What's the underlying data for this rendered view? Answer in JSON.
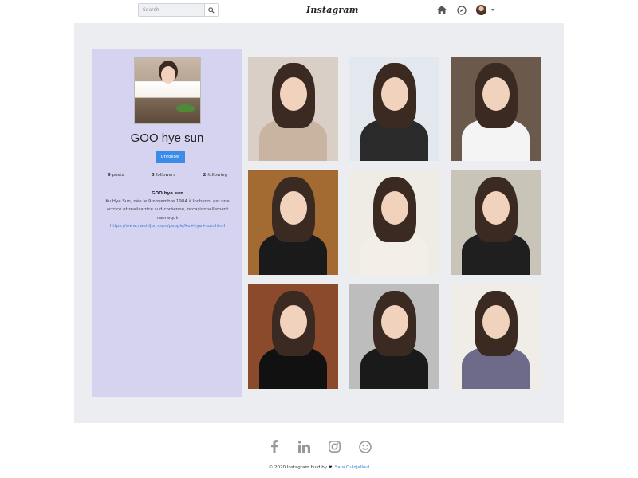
{
  "navbar": {
    "search_placeholder": "Search",
    "logo": "Instagram",
    "icons": [
      "home-icon",
      "explore-icon",
      "avatar",
      "caret-down-icon"
    ]
  },
  "profile": {
    "name": "GOO hye sun",
    "unfollow_label": "Unfollow",
    "stats": {
      "posts_count": "9",
      "posts_label": "posts",
      "followers_count": "3",
      "followers_label": "followers",
      "following_count": "2",
      "following_label": "following"
    },
    "bio_title": "GOO hye sun",
    "bio_text": "Ku Hye Sun, née le 9 novembre 1984 à Incheon, est une actrice et réalisatrice sud-coréenne, occasionnellement mannequin",
    "bio_link": "https://www.nautiljon.com/people/ku+hye+sun.html"
  },
  "grid": {
    "photos": [
      {
        "caption": "",
        "bg": "#d9cfc6",
        "outfit": "#c8b4a1"
      },
      {
        "caption": "",
        "bg": "#e3e8ee",
        "outfit": "#2a2a2a"
      },
      {
        "caption": "",
        "bg": "#6b5a4c",
        "outfit": "#f4f4f4"
      },
      {
        "caption": "",
        "bg": "#a36a32",
        "outfit": "#1a1a1a"
      },
      {
        "caption": "",
        "bg": "#efece6",
        "outfit": "#f3efe8"
      },
      {
        "caption": "",
        "bg": "#c9c4b8",
        "outfit": "#1f1f1f"
      },
      {
        "caption": "",
        "bg": "#8c4a2c",
        "outfit": "#111111"
      },
      {
        "caption": "",
        "bg": "#bdbdbd",
        "outfit": "#1a1a1a"
      },
      {
        "caption": "",
        "bg": "#f0ece8",
        "outfit": "#6d6a8a"
      }
    ]
  },
  "footer": {
    "icons": [
      "facebook-icon",
      "linkedin-icon",
      "instagram-icon",
      "smile-icon"
    ],
    "copyright_prefix": "© 2020 Instagram buid by",
    "author": "Sara Ouldjelloul"
  },
  "colors": {
    "accent": "#3c8ce7",
    "profile_bg": "#d6d3f1",
    "main_bg": "#ebedf0",
    "link": "#2f7bd9"
  }
}
